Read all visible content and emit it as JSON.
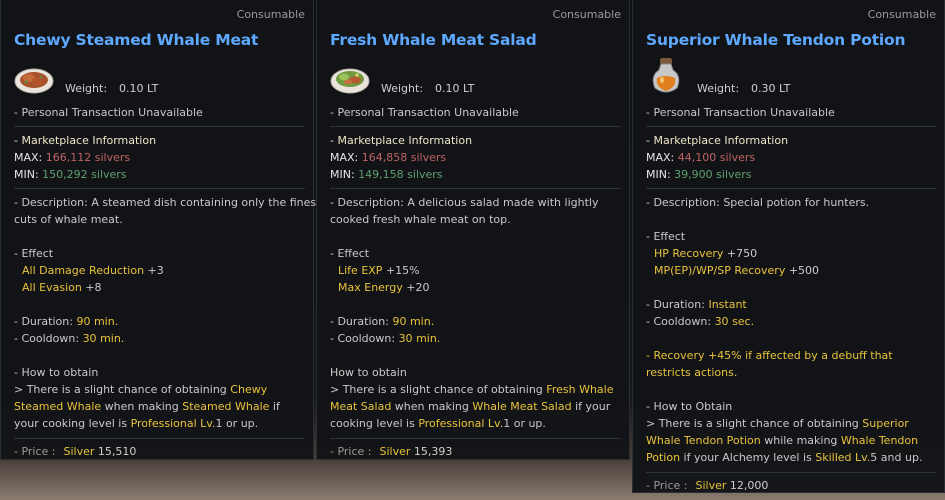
{
  "cards": [
    {
      "category": "Consumable",
      "name": "Chewy Steamed Whale Meat",
      "icon": "steamed-meat-dish-icon",
      "weight_label": "Weight:",
      "weight_value": "0.10 LT",
      "transaction": "- Personal Transaction Unavailable",
      "market_header": "- Marketplace Information",
      "max_label": "MAX:",
      "max_value": "166,112 silvers",
      "min_label": "MIN:",
      "min_value": "150,292 silvers",
      "desc_line1": "- Description: A steamed dish containing only the finest",
      "desc_line2": "cuts of whale meat.",
      "effect_header": "- Effect",
      "effects": [
        {
          "name": "All Damage Reduction",
          "value": "+3"
        },
        {
          "name": "All Evasion",
          "value": "+8"
        }
      ],
      "duration_label": "- Duration:",
      "duration_value": "90",
      "duration_unit": "min.",
      "cooldown_label": "- Cooldown:",
      "cooldown_value": "30",
      "cooldown_unit": "min.",
      "obtain_header": "- How to obtain",
      "obtain": {
        "p1": "> There is a slight chance of obtaining ",
        "item": "Chewy Steamed Whale",
        "p2": " when making ",
        "target": "Steamed Whale",
        "p3": " if your cooking level is ",
        "level": "Professional Lv.",
        "level_num": "1",
        "p4": " or up."
      },
      "price_label": "- Price :",
      "price_currency": "Silver",
      "price_value": "15,510"
    },
    {
      "category": "Consumable",
      "name": "Fresh Whale Meat Salad",
      "icon": "salad-dish-icon",
      "weight_label": "Weight:",
      "weight_value": "0.10 LT",
      "transaction": "- Personal Transaction Unavailable",
      "market_header": "- Marketplace Information",
      "max_label": "MAX:",
      "max_value": "164,858 silvers",
      "min_label": "MIN:",
      "min_value": "149,158 silvers",
      "desc_line1": "- Description: A delicious salad made with lightly",
      "desc_line2": "cooked fresh whale meat on top.",
      "effect_header": "- Effect",
      "effects": [
        {
          "name": "Life EXP",
          "value": "+15%"
        },
        {
          "name": "Max Energy",
          "value": "+20"
        }
      ],
      "duration_label": "- Duration:",
      "duration_value": "90",
      "duration_unit": "min.",
      "cooldown_label": "- Cooldown:",
      "cooldown_value": "30",
      "cooldown_unit": "min.",
      "obtain_header": "How to obtain",
      "obtain": {
        "p1": " > There is a slight chance of obtaining ",
        "item": "Fresh Whale Meat Salad",
        "p2": " when making ",
        "target": "Whale Meat Salad",
        "p3": " if your cooking level is ",
        "level": "Professional Lv.",
        "level_num": "1",
        "p4": " or up."
      },
      "price_label": "- Price :",
      "price_currency": "Silver",
      "price_value": "15,393"
    },
    {
      "category": "Consumable",
      "name": "Superior Whale Tendon Potion",
      "icon": "potion-bottle-icon",
      "weight_label": "Weight:",
      "weight_value": "0.30 LT",
      "transaction": "- Personal Transaction Unavailable",
      "market_header": "- Marketplace Information",
      "max_label": "MAX:",
      "max_value": "44,100 silvers",
      "min_label": "MIN:",
      "min_value": "39,900 silvers",
      "desc_line1": "- Description: Special potion for hunters.",
      "effect_header": "- Effect",
      "effects": [
        {
          "name": "HP Recovery",
          "value": "+750"
        },
        {
          "name": "MP(EP)/WP/SP Recovery",
          "value": "+500"
        }
      ],
      "duration_label": "- Duration:",
      "duration_value": "Instant",
      "cooldown_label": "- Cooldown:",
      "cooldown_value": "30",
      "cooldown_unit": "sec.",
      "extra_note": "- Recovery +45% if affected by a debuff that restricts actions.",
      "obtain_header": "- How to Obtain",
      "obtain": {
        "p1": " > There is a slight chance of obtaining ",
        "item": "Superior Whale Tendon Potion",
        "p2": " while making ",
        "target": "Whale Tendon Potion",
        "p3": " if your Alchemy level is ",
        "level": "Skilled Lv.",
        "level_num": "5",
        "p4": " and up."
      },
      "price_label": "- Price :",
      "price_currency": "Silver",
      "price_value": "12,000"
    }
  ],
  "colors": {
    "title": "#5ea8ff",
    "max": "#c06464",
    "min": "#5fa070",
    "highlight": "#e9c33b"
  }
}
